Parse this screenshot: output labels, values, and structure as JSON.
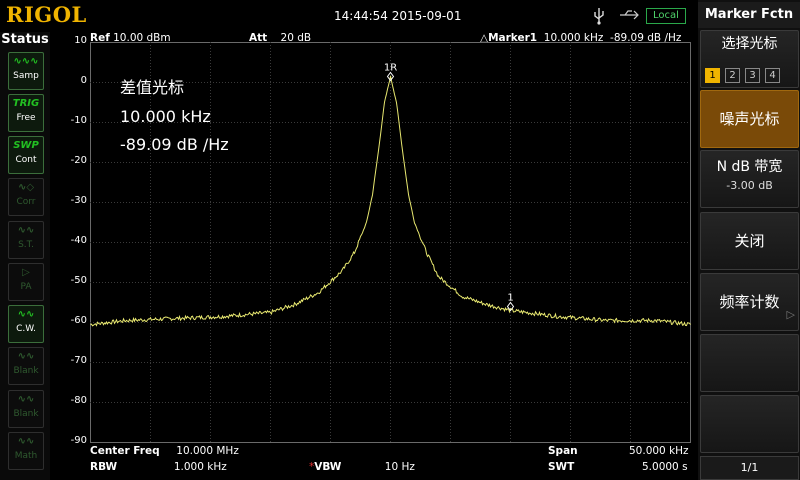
{
  "brand": "RIGOL",
  "datetime": "14:44:54 2015-09-01",
  "remote_status": "Local",
  "status": {
    "title": "Status",
    "buttons": [
      {
        "icon": "∿∿∿",
        "label": "Samp",
        "on": true
      },
      {
        "icon": "TRIG",
        "label": "Free",
        "on": true
      },
      {
        "icon": "SWP",
        "label": "Cont",
        "on": true
      },
      {
        "icon": "∿◇",
        "label": "Corr",
        "on": false
      },
      {
        "icon": "∿∿",
        "label": "S.T.",
        "on": false
      },
      {
        "icon": "▷",
        "label": "PA",
        "on": false
      },
      {
        "icon": "∿∿",
        "label": "C.W.",
        "on": true
      },
      {
        "icon": "∿∿",
        "label": "Blank",
        "on": false
      },
      {
        "icon": "∿∿",
        "label": "Blank",
        "on": false
      },
      {
        "icon": "∿∿",
        "label": "Math",
        "on": false
      }
    ]
  },
  "header": {
    "ref_label": "Ref",
    "ref_value": "10.00 dBm",
    "att_label": "Att",
    "att_value": "20 dB",
    "marker_label": "△Marker1",
    "marker_freq": "10.000 kHz",
    "marker_level": "-89.09 dB /Hz"
  },
  "delta_marker": {
    "title": "差值光标",
    "freq": "10.000 kHz",
    "level": "-89.09 dB /Hz"
  },
  "footer": {
    "center_label": "Center Freq",
    "center_value": "10.000 MHz",
    "span_label": "Span",
    "span_value": "50.000 kHz",
    "rbw_label": "RBW",
    "rbw_value": "1.000 kHz",
    "vbw_star": "*",
    "vbw_label": "VBW",
    "vbw_value": "10 Hz",
    "swt_label": "SWT",
    "swt_value": "5.0000 s"
  },
  "chart_data": {
    "type": "line",
    "title": "",
    "xlabel": "",
    "ylabel": "",
    "yticks": [
      "10",
      "0",
      "-10",
      "-20",
      "-30",
      "-40",
      "-50",
      "-60",
      "-70",
      "-80",
      "-90"
    ],
    "ylim": [
      -90,
      10
    ],
    "xlim": [
      -25,
      25
    ],
    "grid": true,
    "series": [
      {
        "color": "#e8e870",
        "x": [
          -25,
          -22,
          -18,
          -14,
          -10,
          -8,
          -6,
          -4,
          -3,
          -2,
          -1.5,
          -1,
          -0.5,
          0,
          0.5,
          1,
          1.5,
          2,
          3,
          4,
          6,
          8,
          10,
          14,
          18,
          22,
          25
        ],
        "y": [
          -60.5,
          -59.5,
          -59,
          -58.5,
          -57.5,
          -55.5,
          -52.5,
          -47,
          -42.5,
          -35,
          -28,
          -17,
          -5,
          1.5,
          -5,
          -17,
          -28,
          -35,
          -42.5,
          -48.5,
          -53.5,
          -55.5,
          -57,
          -58.5,
          -59.5,
          -59.5,
          -60.5
        ]
      }
    ],
    "markers": [
      {
        "label": "1R",
        "x": 0,
        "y": 1.5
      },
      {
        "label": "1",
        "x": 10,
        "y": -56
      }
    ]
  },
  "menu": {
    "title": "Marker Fctn",
    "select_marker": {
      "label": "选择光标",
      "numbers": [
        "1",
        "2",
        "3",
        "4"
      ],
      "current": 0
    },
    "noise_marker": "噪声光标",
    "ndb_bw": {
      "label": "N  dB  带宽",
      "value": "-3.00 dB"
    },
    "off": "关闭",
    "freq_count": "频率计数",
    "page": "1/1"
  }
}
